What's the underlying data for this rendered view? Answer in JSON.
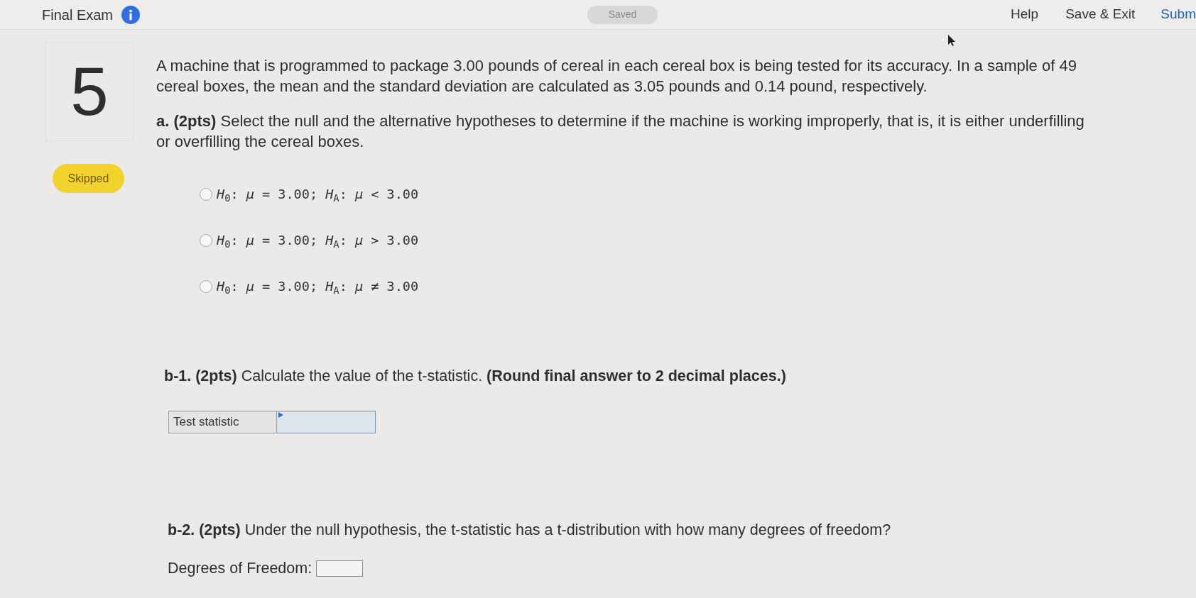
{
  "header": {
    "title": "Final Exam",
    "status": "Saved",
    "links": [
      "Help",
      "Save & Exit",
      "Subm"
    ]
  },
  "question": {
    "number": "5",
    "status": "Skipped",
    "stem": "A machine that is programmed to package 3.00 pounds of cereal in each cereal box is being tested for its accuracy. In a sample of 49 cereal boxes, the mean and the standard deviation are calculated as 3.05 pounds and 0.14 pound, respectively.",
    "parts": [
      {
        "kind": "choice",
        "prompt": "**a. (2pts)** Select the null and the alternative hypotheses to determine if the machine is working improperly, that is, it is either underfilling or overfilling the cereal boxes.",
        "options": [
          {
            "label": "*H*$_{0}$: *μ* = 3.00; *H*$_{A}$: *μ* < 3.00",
            "selected": false
          },
          {
            "label": "*H*$_{0}$: *μ* = 3.00; *H*$_{A}$: *μ* > 3.00",
            "selected": false
          },
          {
            "label": "*H*$_{0}$: *μ* = 3.00; *H*$_{A}$: *μ* ≠ 3.00",
            "selected": false
          }
        ]
      },
      {
        "kind": "table_input",
        "prompt": "**b-1. (2pts)** Calculate the value of the t-statistic. **(Round final answer to 2 decimal places.)**",
        "label": "Test statistic"
      },
      {
        "kind": "inline_input",
        "prompt": "**b-2. (2pts)** Under the null hypothesis, the t-statistic has a t-distribution with how many degrees of freedom?",
        "label": "Degrees of Freedom:"
      }
    ]
  }
}
